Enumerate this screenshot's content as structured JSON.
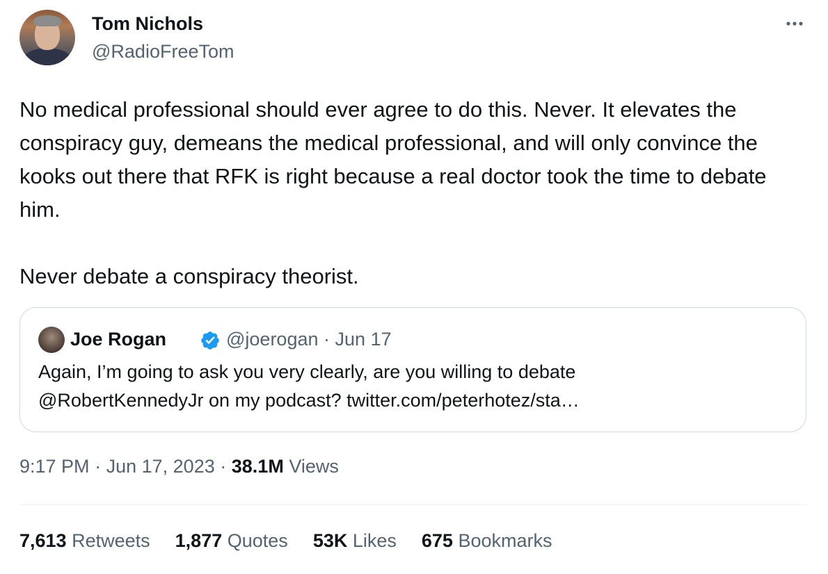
{
  "author": {
    "name": "Tom Nichols",
    "handle": "@RadioFreeTom"
  },
  "tweet": {
    "text": "No medical professional should ever agree to do this. Never. It elevates the conspiracy guy, demeans the medical professional, and will only convince the kooks out there that RFK is right because a real doctor took the time to debate him.\n\nNever debate a conspiracy theorist."
  },
  "quoted_tweet": {
    "name": "Joe Rogan",
    "handle": "@joerogan",
    "separator": "·",
    "date": "Jun 17",
    "verified": true,
    "text": "Again, I’m going to ask you very clearly, are you willing to debate\n@RobertKennedyJr on my podcast? twitter.com/peterhotez/sta…"
  },
  "meta": {
    "time": "9:17 PM",
    "separator": "·",
    "date": "Jun 17, 2023",
    "views_count": "38.1M",
    "views_label": "Views"
  },
  "stats": [
    {
      "count": "7,613",
      "label": "Retweets"
    },
    {
      "count": "1,877",
      "label": "Quotes"
    },
    {
      "count": "53K",
      "label": "Likes"
    },
    {
      "count": "675",
      "label": "Bookmarks"
    }
  ],
  "icons": {
    "more": "more-horizontal-icon",
    "verified": "verified-badge-icon"
  },
  "colors": {
    "text": "#0f1419",
    "secondary": "#536471",
    "verified": "#1d9bf0",
    "border": "#cfd9de"
  }
}
